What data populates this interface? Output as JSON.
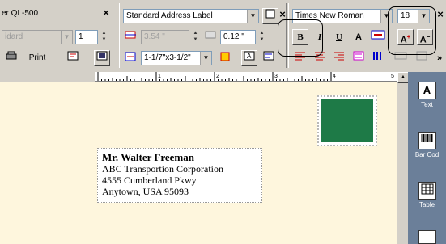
{
  "printer": {
    "title": "er QL-500",
    "media_combo": "idard",
    "copies_value": "1",
    "print_label": "Print"
  },
  "layout": {
    "label_type": "Standard Address Label",
    "width_value": "3.54 \"",
    "margin_value": "0.12 \"",
    "size_combo": "1-1/7\"x3-1/2\""
  },
  "text": {
    "font_name": "Times New Roman",
    "font_size": "18",
    "bold_label": "B",
    "italic_label": "I",
    "underline_label": "U",
    "outline_label": "A",
    "grow_label": "A",
    "shrink_label": "A",
    "more_label": "»"
  },
  "ruler": {
    "numbers": [
      "1",
      "2",
      "3",
      "4",
      "5"
    ]
  },
  "address": {
    "name": "Mr. Walter Freeman",
    "company": "ABC Transportion Corporation",
    "street": "4555 Cumberland Pkwy",
    "city": "Anytown, USA 95093"
  },
  "palette": {
    "text_label": "Text",
    "barcode_label": "Bar Cod",
    "table_label": "Table"
  },
  "colors": {
    "stamp": "#1e7a47",
    "canvas": "#fef6dd",
    "palette": "#6b7f99"
  }
}
